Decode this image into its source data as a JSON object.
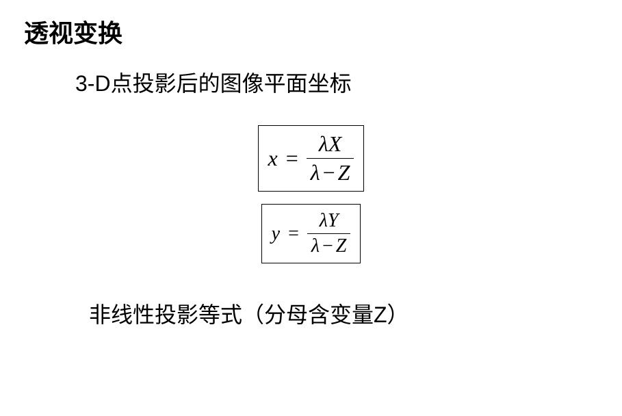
{
  "title": "透视变换",
  "subtitle": "3-D点投影后的图像平面坐标",
  "equation1": {
    "lhs": "x",
    "equals": "=",
    "numerator_lambda": "λ",
    "numerator_var": "X",
    "denominator_lambda": "λ",
    "denominator_minus": "−",
    "denominator_var": "Z"
  },
  "equation2": {
    "lhs": "y",
    "equals": "=",
    "numerator_lambda": "λ",
    "numerator_var": "Y",
    "denominator_lambda": "λ",
    "denominator_minus": "−",
    "denominator_var": "Z"
  },
  "bottom_text": "非线性投影等式（分母含变量Z）"
}
